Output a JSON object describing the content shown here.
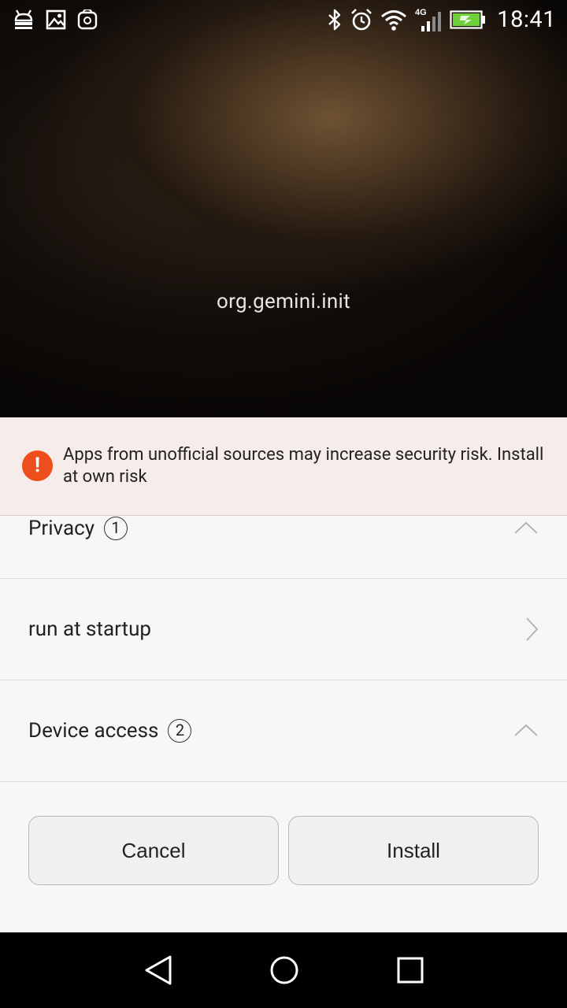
{
  "status_bar": {
    "time": "18:41",
    "network_type": "4G",
    "left_icons": [
      "android-debug-icon",
      "image-icon",
      "huawei-store-icon"
    ],
    "right_icons": [
      "bluetooth-icon",
      "alarm-icon",
      "wifi-icon",
      "cell-signal-icon",
      "battery-charging-icon"
    ],
    "battery_color": "#6fcf3a"
  },
  "app": {
    "package_name": "org.gemini.init"
  },
  "warning": {
    "text": "Apps from unofficial sources may increase security risk. Install at own risk",
    "icon_glyph": "!",
    "icon_color": "#ee4e1c"
  },
  "permissions": {
    "privacy": {
      "label": "Privacy",
      "count": "1",
      "expanded": true
    },
    "startup": {
      "label": "run at startup"
    },
    "device_access": {
      "label": "Device access",
      "count": "2",
      "expanded": true
    }
  },
  "actions": {
    "cancel_label": "Cancel",
    "install_label": "Install"
  },
  "nav": {
    "items": [
      "back-icon",
      "home-icon",
      "recents-icon"
    ]
  }
}
